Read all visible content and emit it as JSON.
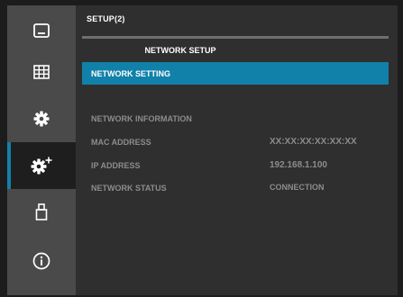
{
  "sidebar": {
    "items": [
      {
        "icon": "picture-icon"
      },
      {
        "icon": "grid-icon"
      },
      {
        "icon": "gear-icon"
      },
      {
        "icon": "gear-plus-icon",
        "active": true
      },
      {
        "icon": "usb-icon"
      },
      {
        "icon": "info-icon"
      }
    ]
  },
  "header": {
    "title": "SETUP(2)",
    "subtitle": "NETWORK SETUP"
  },
  "menu": {
    "selected": "NETWORK SETTING"
  },
  "info": {
    "heading": "NETWORK INFORMATION",
    "rows": [
      {
        "label": "MAC ADDRESS",
        "value": "XX:XX:XX:XX:XX:XX"
      },
      {
        "label": "IP ADDRESS",
        "value": "192.168.1.100"
      },
      {
        "label": "NETWORK STATUS",
        "value": "CONNECTION"
      }
    ]
  },
  "colors": {
    "accent": "#1181a9",
    "sidebar": "#4a4a4a",
    "panel": "#2f2f2f",
    "muted_text": "#8c8c8c"
  }
}
